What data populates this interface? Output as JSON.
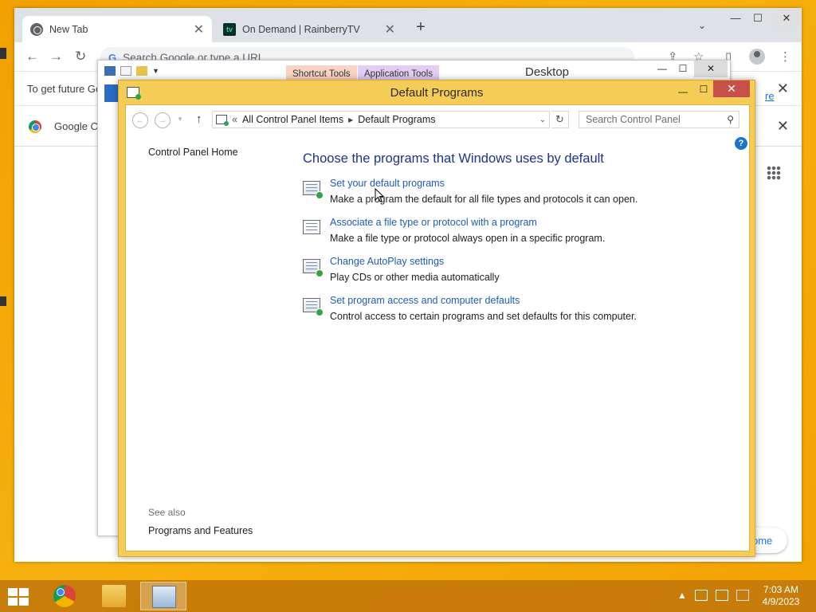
{
  "chrome": {
    "tabs": [
      {
        "title": "New Tab",
        "close": "✕"
      },
      {
        "title": "On Demand | RainberryTV",
        "close": "✕",
        "icon_text": "tv"
      }
    ],
    "new_tab": "+",
    "tab_search": "⌄",
    "window_controls": {
      "minimize": "—",
      "maximize": "☐",
      "close": "✕"
    },
    "omnibox_placeholder": "Search Google or type a URL",
    "omnibox_g": "G",
    "info_bar_text": "To get future Go",
    "info_bar_link": "re",
    "bookmark_text": "Google C",
    "customize_text": "ome"
  },
  "explorer": {
    "title": "Desktop",
    "context_tabs": [
      "Shortcut Tools",
      "Application Tools"
    ],
    "window_controls": {
      "minimize": "—",
      "maximize": "☐",
      "close": "✕"
    }
  },
  "control_panel": {
    "title": "Default Programs",
    "window_controls": {
      "minimize": "—",
      "maximize": "☐",
      "close": "✕"
    },
    "breadcrumb": [
      "All Control Panel Items",
      "Default Programs"
    ],
    "breadcrumb_prefix": "«",
    "search_placeholder": "Search Control Panel",
    "help": "?",
    "sidebar_home": "Control Panel Home",
    "see_also_label": "See also",
    "see_also_link": "Programs and Features",
    "heading": "Choose the programs that Windows uses by default",
    "tasks": [
      {
        "link": "Set your default programs",
        "desc": "Make a program the default for all file types and protocols it can open."
      },
      {
        "link": "Associate a file type or protocol with a program",
        "desc": "Make a file type or protocol always open in a specific program."
      },
      {
        "link": "Change AutoPlay settings",
        "desc": "Play CDs or other media automatically"
      },
      {
        "link": "Set program access and computer defaults",
        "desc": "Control access to certain programs and set defaults for this computer."
      }
    ]
  },
  "taskbar": {
    "clock_time": "7:03 AM",
    "clock_date": "4/9/2023",
    "tray_chevron": "▲"
  },
  "colors": {
    "desktop": "#f2a100",
    "cp_frame": "#f5cc56",
    "link_blue": "#1e5bb4",
    "heading_blue": "#1e3287",
    "close_red": "#c7504a"
  }
}
